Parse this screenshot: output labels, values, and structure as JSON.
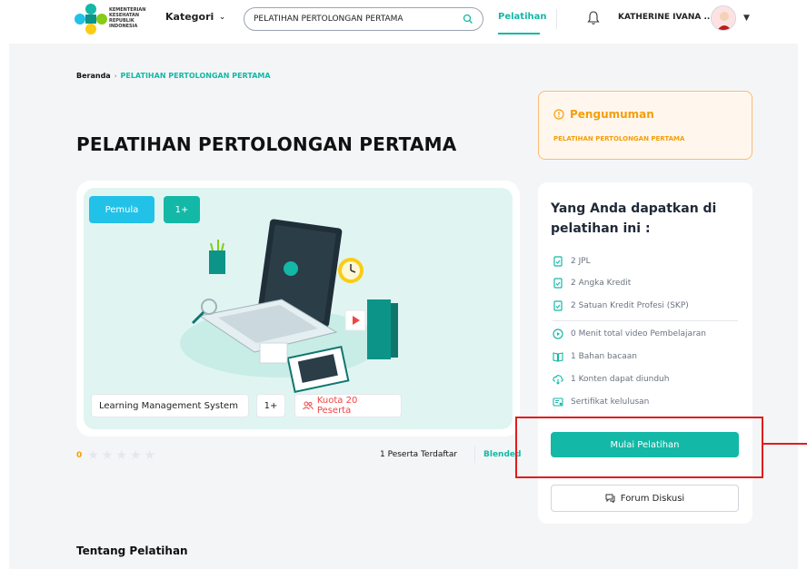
{
  "header": {
    "logo_lines": [
      "KEMENTERIAN",
      "KESEHATAN",
      "REPUBLIK",
      "INDONESIA"
    ],
    "kategori_label": "Kategori",
    "search_value": "PELATIHAN PERTOLONGAN PERTAMA",
    "nav_pelatihan": "Pelatihan",
    "username": "KATHERINE IVANA ..."
  },
  "breadcrumb": {
    "home": "Beranda",
    "current": "PELATIHAN PERTOLONGAN PERTAMA"
  },
  "page_title": "PELATIHAN PERTOLONGAN PERTAMA",
  "announcement": {
    "title": "Pengumuman",
    "body": "PELATIHAN PERTOLONGAN PERTAMA"
  },
  "hero": {
    "level_label": "Pemula",
    "age_label": "1+",
    "tag_lms": "Learning Management System",
    "tag_one": "1+",
    "tag_kuota": "Kuota 20 Peserta"
  },
  "rating": {
    "value": "0",
    "stars_filled": 0,
    "stars_total": 5,
    "peserta": "1 Peserta Terdaftar",
    "mode": "Blended"
  },
  "benefits": {
    "heading": "Yang Anda dapatkan di pelatihan ini :",
    "items": [
      {
        "icon": "document-check-icon",
        "text": "2 JPL"
      },
      {
        "icon": "document-check-icon",
        "text": "2 Angka Kredit"
      },
      {
        "icon": "document-check-icon",
        "text": "2 Satuan Kredit Profesi (SKP)"
      },
      {
        "icon": "play-circle-icon",
        "text": "0 Menit total video Pembelajaran"
      },
      {
        "icon": "book-icon",
        "text": "1 Bahan bacaan"
      },
      {
        "icon": "cloud-download-icon",
        "text": "1 Konten dapat diunduh"
      },
      {
        "icon": "certificate-icon",
        "text": "Sertifikat kelulusan"
      }
    ],
    "cta_label": "Mulai Pelatihan",
    "forum_label": "Forum Diskusi"
  },
  "tentang_heading": "Tentang Pelatihan",
  "colors": {
    "accent": "#14b8a6",
    "warning": "#f59e0b",
    "highlight": "#e11d1d"
  }
}
